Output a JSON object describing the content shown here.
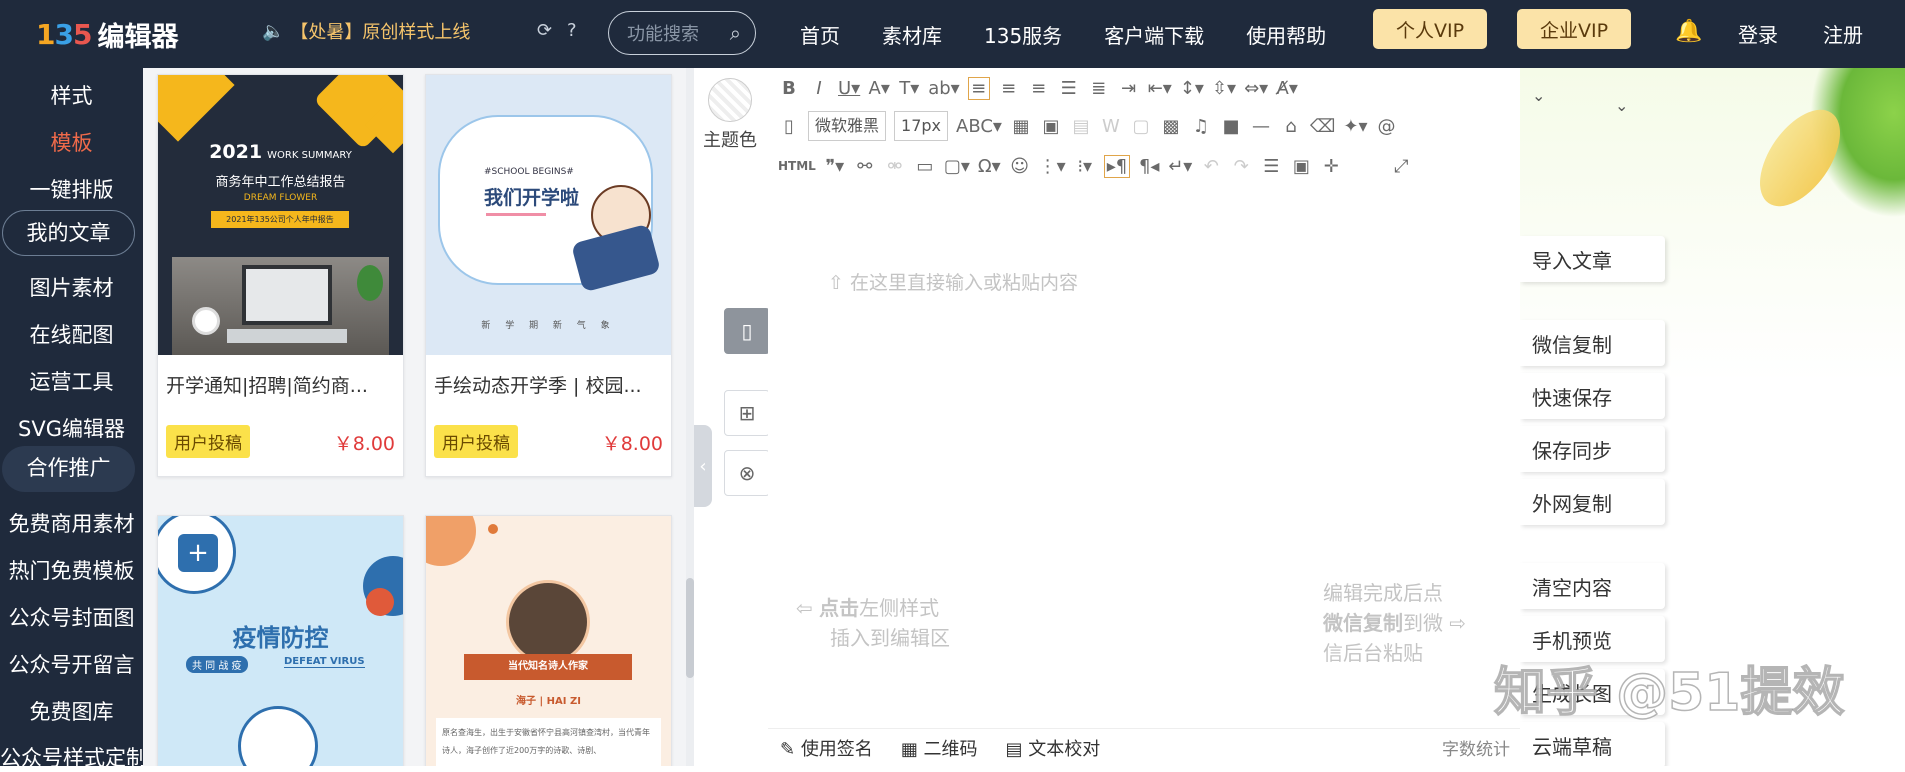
{
  "topbar": {
    "logo_mark": "135",
    "logo_name": "编辑器",
    "announcement": "【处暑】原创样式上线",
    "search_placeholder": "功能搜索",
    "nav": [
      "首页",
      "素材库",
      "135服务",
      "客户端下载",
      "使用帮助"
    ],
    "vip_personal": "个人VIP",
    "vip_enterprise": "企业VIP",
    "login": "登录",
    "register": "注册"
  },
  "sidebar": {
    "items": [
      "样式",
      "模板",
      "一键排版",
      "我的文章",
      "图片素材",
      "在线配图",
      "运营工具",
      "SVG编辑器",
      "合作推广",
      "免费商用素材",
      "热门免费模板",
      "公众号封面图",
      "公众号开留言",
      "免费图库",
      "公众号样式定制"
    ],
    "active_index": 1
  },
  "templates": [
    {
      "title": "开学通知|招聘|简约商...",
      "tag": "用户投稿",
      "price": "￥8.00",
      "thumb_year": "2021",
      "thumb_sub": "WORK SUMMARY",
      "thumb_line1": "商务年中工作总结报告",
      "thumb_line2": "DREAM FLOWER",
      "thumb_line3": "2021年135公司个人年中报告"
    },
    {
      "title": "手绘动态开学季 | 校园...",
      "tag": "用户投稿",
      "price": "￥8.00",
      "thumb_en": "#SCHOOL BEGINS#",
      "thumb_cn": "我们开学啦",
      "thumb_chars": "新 学 期 新 气 象"
    },
    {
      "title": "",
      "thumb_cn": "疫情防控",
      "thumb_chips": "共 同 战 疫",
      "thumb_en": "DEFEAT VIRUS"
    },
    {
      "title": "",
      "thumb_banner": "当代知名诗人作家",
      "thumb_author": "海子 | HAI ZI",
      "thumb_body": "原名查海生，出生于安徽省怀宁县高河镇查湾村，当代青年诗人，海子创作了近200万字的诗歌、诗剧、"
    }
  ],
  "editor": {
    "theme_label": "主题色",
    "font_family": "微软雅黑",
    "font_size": "17px",
    "placeholder": "在这里直接输入或粘贴内容",
    "hint_left_line1a": "点击",
    "hint_left_line1b": "左侧样式",
    "hint_left_line2": "插入到编辑区",
    "hint_right_line1": "编辑完成后点",
    "hint_right_line2a": "微信复制",
    "hint_right_line2b": "到微",
    "hint_right_line3": "信后台粘贴",
    "footer_signature": "使用签名",
    "footer_qrcode": "二维码",
    "footer_proofread": "文本校对",
    "footer_wordcount": "字数统计"
  },
  "right_panel": {
    "buttons": [
      "导入文章",
      "微信复制",
      "快速保存",
      "保存同步",
      "外网复制",
      "清空内容",
      "手机预览",
      "生成长图",
      "云端草稿"
    ]
  },
  "watermark": "知乎 @51提效"
}
